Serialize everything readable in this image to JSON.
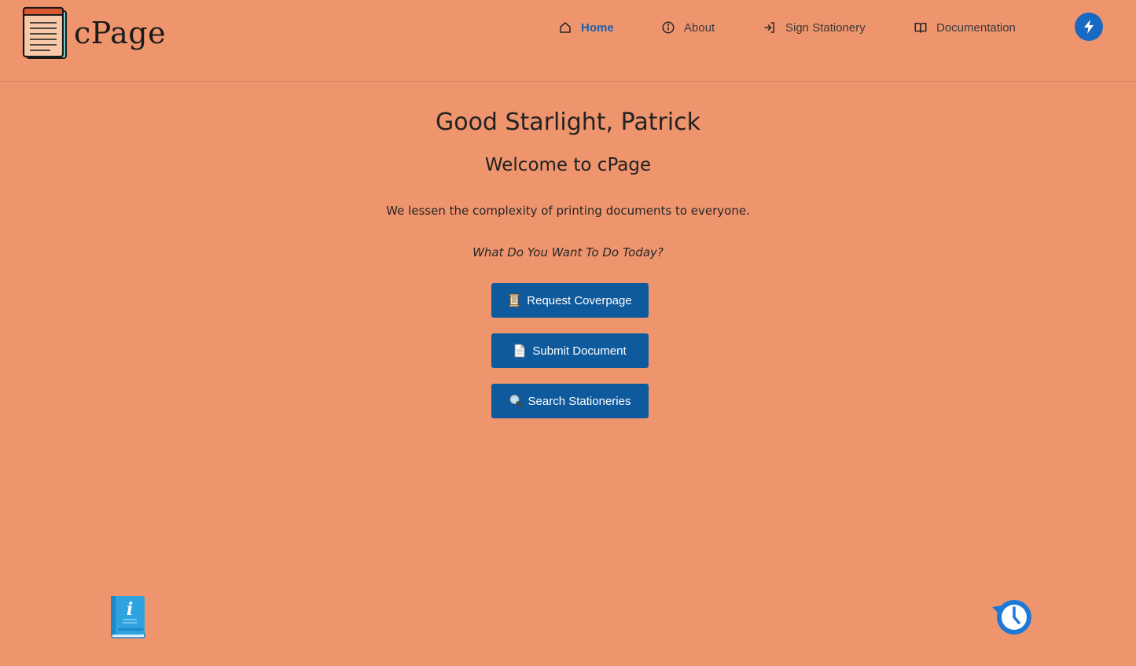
{
  "brand": {
    "name": "cPage",
    "logo_icon": "document-notepad-icon"
  },
  "nav": {
    "items": [
      {
        "label": "Home",
        "icon": "home-icon",
        "active": true
      },
      {
        "label": "About",
        "icon": "info-circle-icon",
        "active": false
      },
      {
        "label": "Sign Stationery",
        "icon": "sign-in-icon",
        "active": false
      },
      {
        "label": "Documentation",
        "icon": "open-book-icon",
        "active": false
      }
    ],
    "quick_action_icon": "lightning-bolt-icon"
  },
  "hero": {
    "greeting": "Good Starlight, Patrick",
    "welcome": "Welcome to cPage",
    "tagline": "We lessen the complexity of printing documents to everyone.",
    "question": "What Do You Want To Do Today?"
  },
  "actions": [
    {
      "label": "Request Coverpage",
      "icon": "scroll-icon"
    },
    {
      "label": "Submit Document",
      "icon": "page-icon"
    },
    {
      "label": "Search Stationeries",
      "icon": "magnifier-icon"
    }
  ],
  "floating": {
    "left_icon": "info-book-icon",
    "right_icon": "history-clock-icon"
  },
  "colors": {
    "background": "#EF956E",
    "accent": "#1A5FA8",
    "button": "#0E5A9C",
    "bolt_button": "#1769C2"
  }
}
